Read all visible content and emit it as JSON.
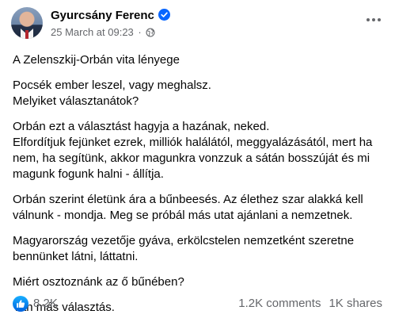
{
  "post": {
    "author": "Gyurcsány Ferenc",
    "timestamp": "25 March at 09:23",
    "separator": "·",
    "paragraphs": [
      "A Zelenszkij-Orbán vita lényege",
      "Pocsék ember leszel, vagy meghalsz.\nMelyiket választanátok?",
      "Orbán ezt a választást hagyja a hazának, neked.\nElfordítjuk fejünket ezrek, milliók halálától, meggyalázásától, mert ha nem, ha segítünk, akkor magunkra vonzzuk a sátán bosszúját és mi magunk fogunk halni - állítja.",
      "Orbán szerint életünk ára a bűnbeesés. Az élethez szar alakká kell válnunk - mondja. Meg se próbál más utat ajánlani a nemzetnek.",
      "Magyarország vezetője gyáva, erkölcstelen nemzetként szeretne bennünket látni, láttatni.",
      "Miért osztoznánk az ő bűnében?",
      "Van más választás."
    ]
  },
  "reactions": {
    "count": "8.2K",
    "comments": "1.2K comments",
    "shares": "1K shares"
  },
  "icons": {
    "verified": "verified-badge-icon",
    "audience": "globe-icon",
    "more": "more-options-icon",
    "like": "like-icon"
  },
  "colors": {
    "verified_blue": "#0866ff",
    "secondary_text": "#65676b",
    "primary_text": "#050505"
  }
}
